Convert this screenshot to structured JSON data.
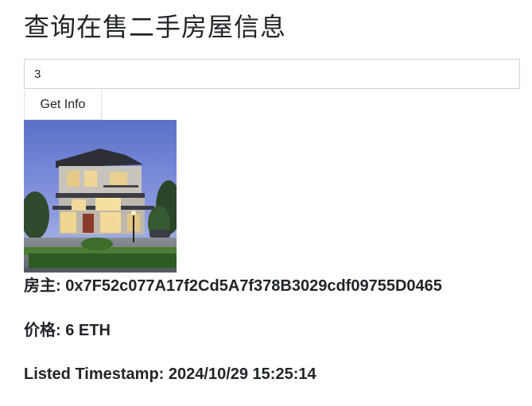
{
  "page": {
    "title": "查询在售二手房屋信息"
  },
  "query": {
    "input_value": "3",
    "button_label": "Get Info"
  },
  "house": {
    "image_icon": "house-photo",
    "owner_label": "房主:",
    "owner_value": "0x7F52c077A17f2Cd5A7f378B3029cdf09755D0465",
    "price_label": "价格:",
    "price_value": "6 ETH",
    "timestamp_label": "Listed Timestamp:",
    "timestamp_value": "2024/10/29 15:25:14"
  }
}
